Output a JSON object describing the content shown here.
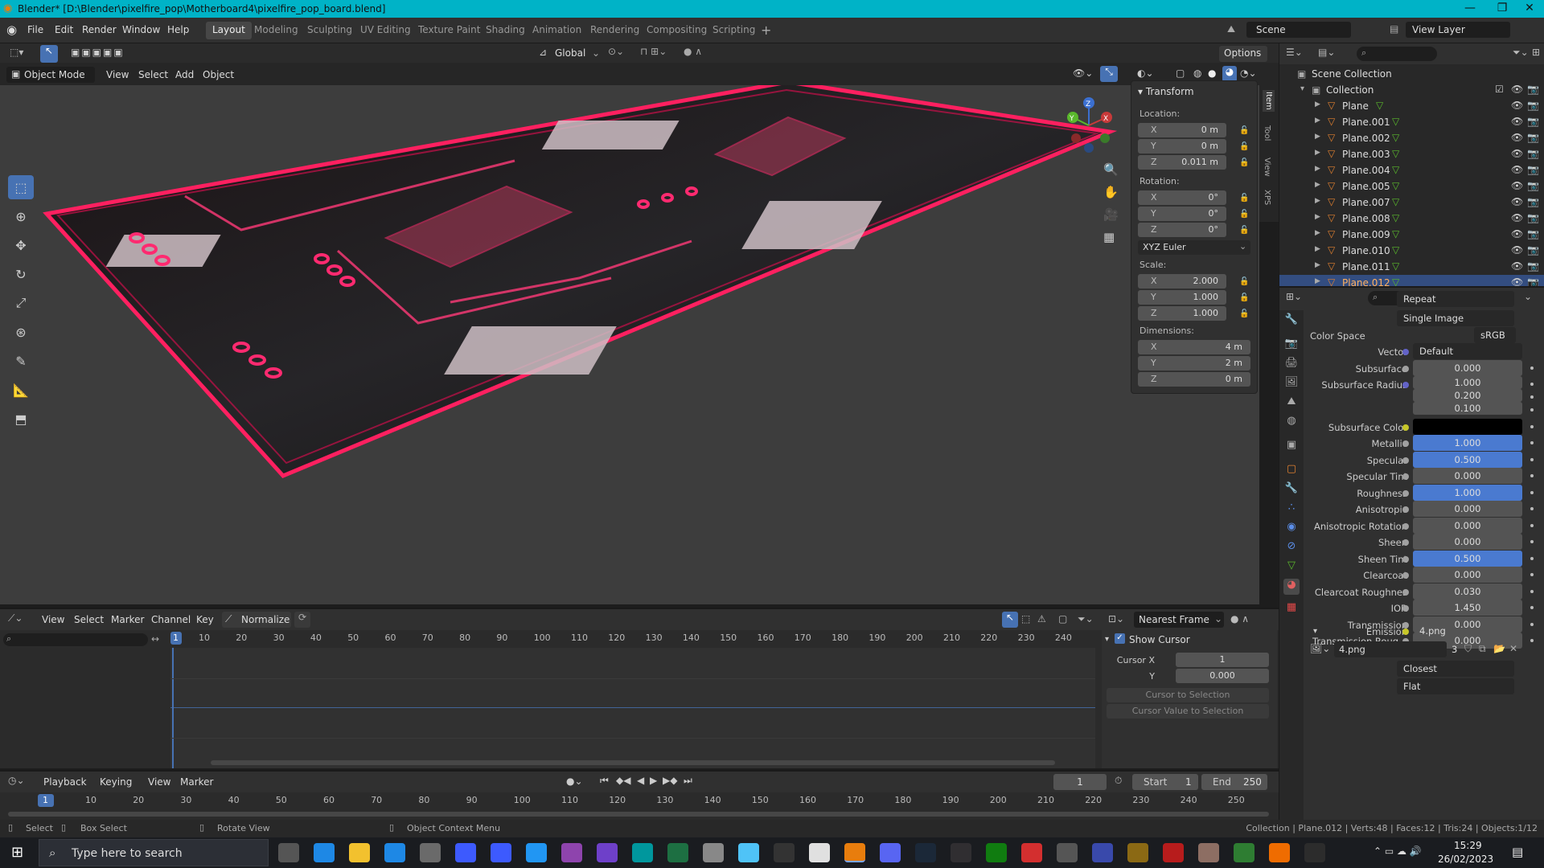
{
  "titlebar": {
    "title": "Blender* [D:\\Blender\\pixelfire_pop\\Motherboard4\\pixelfire_pop_board.blend]"
  },
  "menu": [
    "File",
    "Edit",
    "Render",
    "Window",
    "Help"
  ],
  "workspaces": [
    "Layout",
    "Modeling",
    "Sculpting",
    "UV Editing",
    "Texture Paint",
    "Shading",
    "Animation",
    "Rendering",
    "Compositing",
    "Scripting"
  ],
  "workspace_active": "Layout",
  "top_right": {
    "scene": "Scene",
    "view_layer": "View Layer"
  },
  "tool_header": {
    "orientation": "Global",
    "options": "Options"
  },
  "viewport_header": {
    "mode": "Object Mode",
    "items": [
      "View",
      "Select",
      "Add",
      "Object"
    ]
  },
  "n_panel": {
    "title": "Transform",
    "location_label": "Location:",
    "location": [
      {
        "ax": "X",
        "v": "0 m"
      },
      {
        "ax": "Y",
        "v": "0 m"
      },
      {
        "ax": "Z",
        "v": "0.011 m"
      }
    ],
    "rotation_label": "Rotation:",
    "rotation": [
      {
        "ax": "X",
        "v": "0°"
      },
      {
        "ax": "Y",
        "v": "0°"
      },
      {
        "ax": "Z",
        "v": "0°"
      }
    ],
    "rotation_mode": "XYZ Euler",
    "scale_label": "Scale:",
    "scale": [
      {
        "ax": "X",
        "v": "2.000"
      },
      {
        "ax": "Y",
        "v": "1.000"
      },
      {
        "ax": "Z",
        "v": "1.000"
      }
    ],
    "dimensions_label": "Dimensions:",
    "dimensions": [
      {
        "ax": "X",
        "v": "4 m"
      },
      {
        "ax": "Y",
        "v": "2 m"
      },
      {
        "ax": "Z",
        "v": "0 m"
      }
    ],
    "tabs": [
      "Item",
      "Tool",
      "View",
      "XPS"
    ]
  },
  "outliner": {
    "root": "Scene Collection",
    "collection": "Collection",
    "items": [
      "Plane",
      "Plane.001",
      "Plane.002",
      "Plane.003",
      "Plane.004",
      "Plane.005",
      "Plane.007",
      "Plane.008",
      "Plane.009",
      "Plane.010",
      "Plane.011",
      "Plane.012"
    ],
    "selected": "Plane.012"
  },
  "properties": {
    "top_dropdowns": [
      "Repeat",
      "Single Image"
    ],
    "color_space_label": "Color Space",
    "color_space": "sRGB",
    "vector_label": "Vector",
    "vector": "Default",
    "rows": [
      {
        "label": "Subsurface",
        "value": "0.000",
        "blue": false
      },
      {
        "label": "Subsurface Radius",
        "value": "1.000",
        "blue": false
      },
      {
        "label": "",
        "value": "0.200",
        "blue": false
      },
      {
        "label": "",
        "value": "0.100",
        "blue": false
      },
      {
        "label": "Subsurface Color",
        "value": "",
        "blue": false
      },
      {
        "label": "Metallic",
        "value": "1.000",
        "blue": true
      },
      {
        "label": "Specular",
        "value": "0.500",
        "blue": true
      },
      {
        "label": "Specular Tint",
        "value": "0.000",
        "blue": false
      },
      {
        "label": "Roughness",
        "value": "1.000",
        "blue": true
      },
      {
        "label": "Anisotropic",
        "value": "0.000",
        "blue": false
      },
      {
        "label": "Anisotropic Rotation",
        "value": "0.000",
        "blue": false
      },
      {
        "label": "Sheen",
        "value": "0.000",
        "blue": false
      },
      {
        "label": "Sheen Tint",
        "value": "0.500",
        "blue": true
      },
      {
        "label": "Clearcoat",
        "value": "0.000",
        "blue": false
      },
      {
        "label": "Clearcoat Roughnes",
        "value": "0.030",
        "blue": false
      },
      {
        "label": "IOR",
        "value": "1.450",
        "blue": false
      },
      {
        "label": "Transmission",
        "value": "0.000",
        "blue": false
      },
      {
        "label": "Transmission Roug...",
        "value": "0.000",
        "blue": false
      }
    ],
    "emission_label": "Emission",
    "emission_value": "4.png",
    "image_name": "4.png",
    "image_users": "3",
    "bottom_dropdowns": [
      "Closest",
      "Flat"
    ]
  },
  "graph_editor": {
    "menu": [
      "View",
      "Select",
      "Marker",
      "Channel",
      "Key"
    ],
    "normalize": "Normalize",
    "snap": "Nearest Frame",
    "ruler": [
      "1",
      "10",
      "20",
      "30",
      "40",
      "50",
      "60",
      "70",
      "80",
      "90",
      "100",
      "110",
      "120",
      "130",
      "140",
      "150",
      "160",
      "170",
      "180",
      "190",
      "200",
      "210",
      "220",
      "230",
      "240"
    ],
    "show_cursor": "Show Cursor",
    "cursor_x_label": "Cursor X",
    "cursor_x": "1",
    "cursor_y_label": "Y",
    "cursor_y": "0.000",
    "btn_cursor_sel": "Cursor to Selection",
    "btn_value_sel": "Cursor Value to Selection"
  },
  "timeline": {
    "menu": [
      "Playback",
      "Keying",
      "View",
      "Marker"
    ],
    "current_frame": "1",
    "start_label": "Start",
    "start": "1",
    "end_label": "End",
    "end": "250",
    "ruler": [
      "1",
      "10",
      "20",
      "30",
      "40",
      "50",
      "60",
      "70",
      "80",
      "90",
      "100",
      "110",
      "120",
      "130",
      "140",
      "150",
      "160",
      "170",
      "180",
      "190",
      "200",
      "210",
      "220",
      "230",
      "240",
      "250"
    ]
  },
  "statusbar": {
    "select": "Select",
    "box_select": "Box Select",
    "rotate_view": "Rotate View",
    "context_menu": "Object Context Menu",
    "stats": "Collection | Plane.012 | Verts:48 | Faces:12 | Tris:24 | Objects:1/12"
  },
  "taskbar": {
    "search_placeholder": "Type here to search",
    "time": "15:29",
    "date": "26/02/2023"
  }
}
